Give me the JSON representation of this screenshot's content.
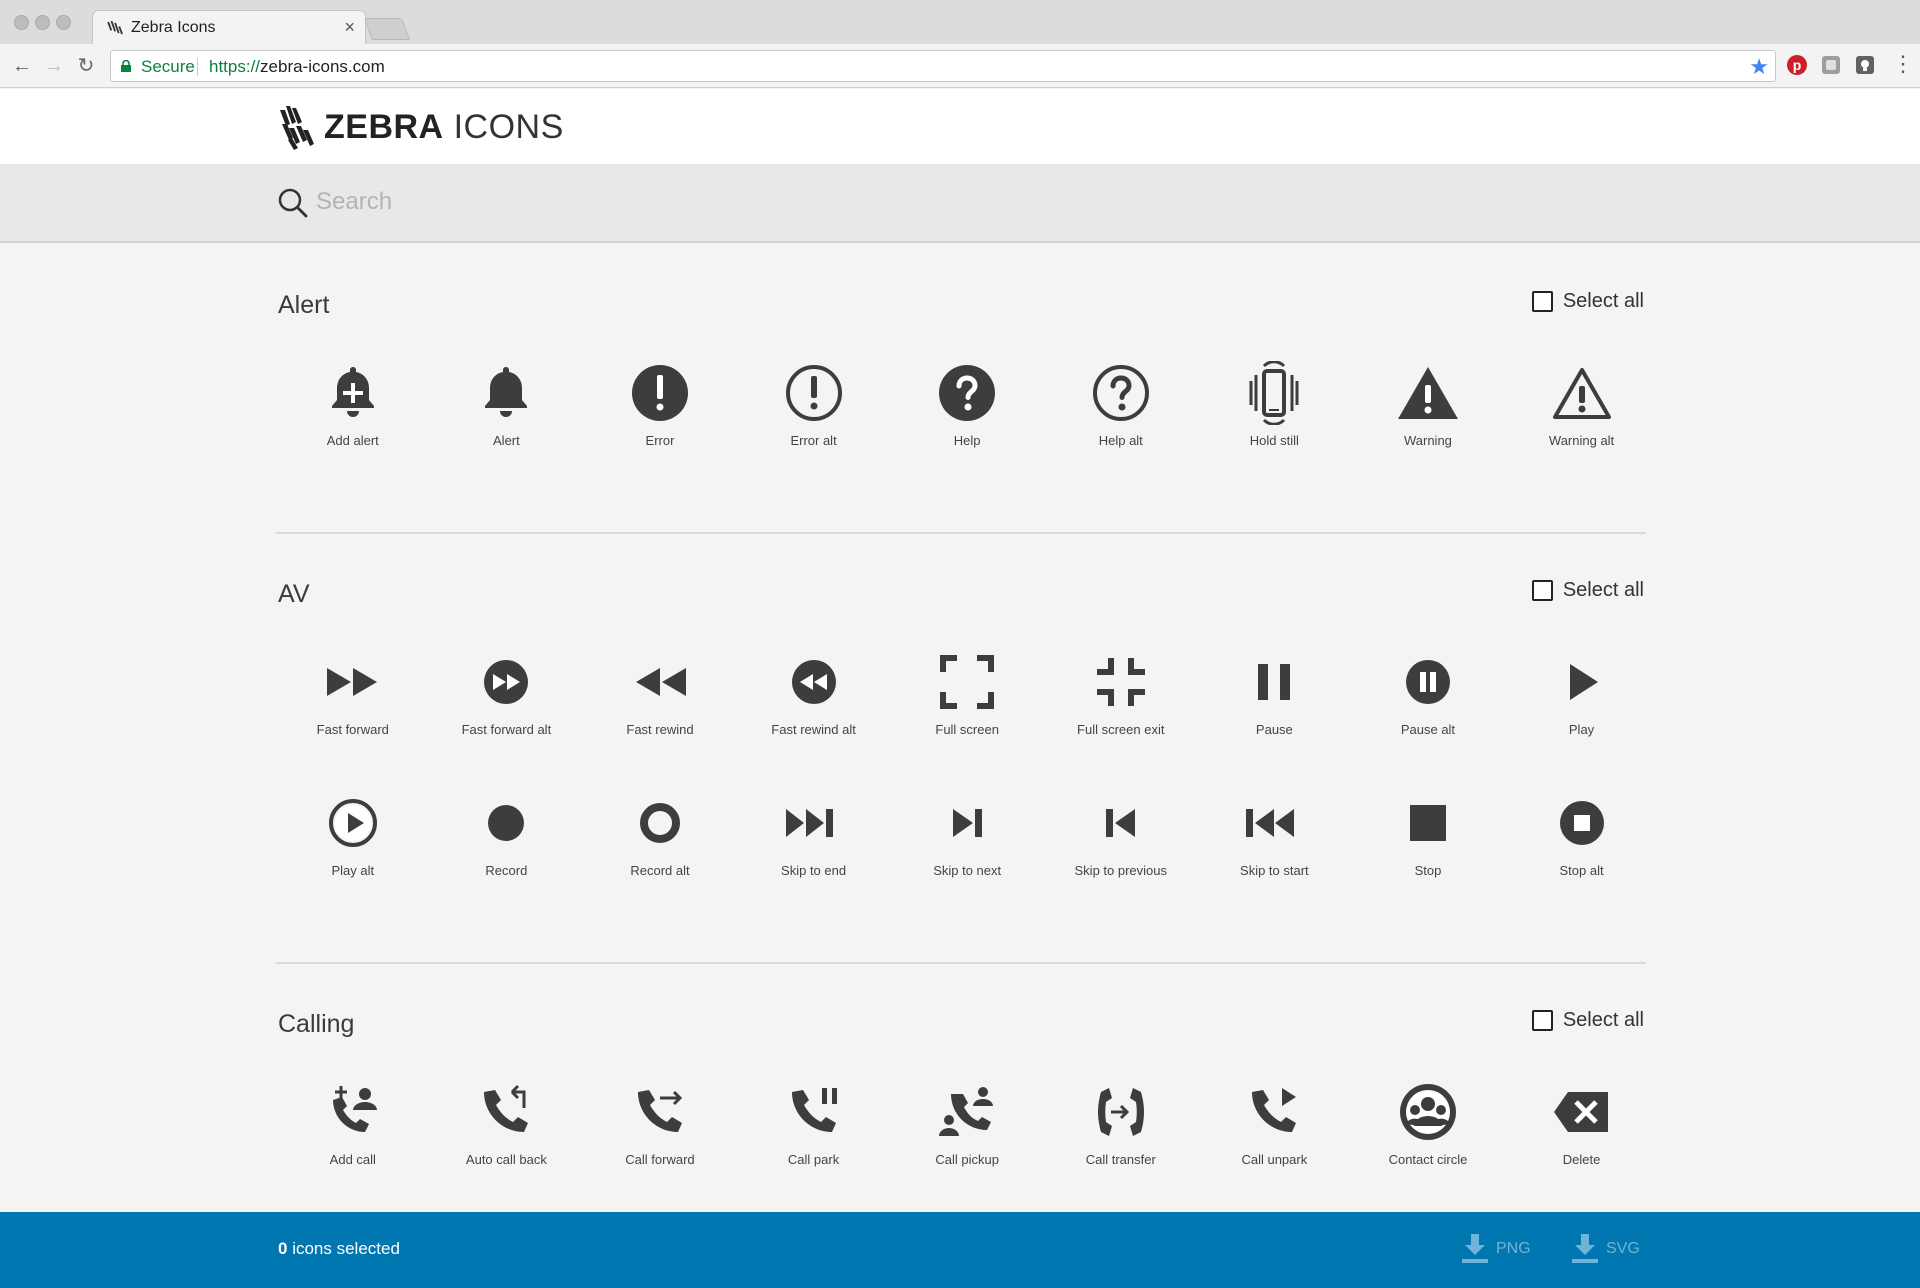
{
  "browser": {
    "tab_title": "Zebra Icons",
    "tab_close": "×",
    "secure_label": "Secure",
    "url_scheme": "https://",
    "url_host": "zebra-icons.com"
  },
  "header": {
    "logo_bold": "ZEBRA",
    "logo_light": "ICONS"
  },
  "search": {
    "placeholder": "Search"
  },
  "sections": [
    {
      "title": "Alert",
      "select_all": "Select all",
      "icons": [
        {
          "label": "Add alert",
          "icon": "add-alert-icon"
        },
        {
          "label": "Alert",
          "icon": "alert-icon"
        },
        {
          "label": "Error",
          "icon": "error-icon"
        },
        {
          "label": "Error alt",
          "icon": "error-alt-icon"
        },
        {
          "label": "Help",
          "icon": "help-icon"
        },
        {
          "label": "Help alt",
          "icon": "help-alt-icon"
        },
        {
          "label": "Hold still",
          "icon": "hold-still-icon"
        },
        {
          "label": "Warning",
          "icon": "warning-icon"
        },
        {
          "label": "Warning alt",
          "icon": "warning-alt-icon"
        }
      ]
    },
    {
      "title": "AV",
      "select_all": "Select all",
      "icons": [
        {
          "label": "Fast forward",
          "icon": "fast-forward-icon"
        },
        {
          "label": "Fast forward alt",
          "icon": "fast-forward-alt-icon"
        },
        {
          "label": "Fast rewind",
          "icon": "fast-rewind-icon"
        },
        {
          "label": "Fast rewind alt",
          "icon": "fast-rewind-alt-icon"
        },
        {
          "label": "Full screen",
          "icon": "full-screen-icon"
        },
        {
          "label": "Full screen exit",
          "icon": "full-screen-exit-icon"
        },
        {
          "label": "Pause",
          "icon": "pause-icon"
        },
        {
          "label": "Pause alt",
          "icon": "pause-alt-icon"
        },
        {
          "label": "Play",
          "icon": "play-icon"
        },
        {
          "label": "Play alt",
          "icon": "play-alt-icon"
        },
        {
          "label": "Record",
          "icon": "record-icon"
        },
        {
          "label": "Record alt",
          "icon": "record-alt-icon"
        },
        {
          "label": "Skip to end",
          "icon": "skip-to-end-icon"
        },
        {
          "label": "Skip to next",
          "icon": "skip-to-next-icon"
        },
        {
          "label": "Skip to previous",
          "icon": "skip-to-previous-icon"
        },
        {
          "label": "Skip to start",
          "icon": "skip-to-start-icon"
        },
        {
          "label": "Stop",
          "icon": "stop-icon"
        },
        {
          "label": "Stop alt",
          "icon": "stop-alt-icon"
        }
      ]
    },
    {
      "title": "Calling",
      "select_all": "Select all",
      "icons": [
        {
          "label": "Add call",
          "icon": "add-call-icon"
        },
        {
          "label": "Auto call back",
          "icon": "auto-call-back-icon"
        },
        {
          "label": "Call forward",
          "icon": "call-forward-icon"
        },
        {
          "label": "Call park",
          "icon": "call-park-icon"
        },
        {
          "label": "Call pickup",
          "icon": "call-pickup-icon"
        },
        {
          "label": "Call transfer",
          "icon": "call-transfer-icon"
        },
        {
          "label": "Call unpark",
          "icon": "call-unpark-icon"
        },
        {
          "label": "Contact circle",
          "icon": "contact-circle-icon"
        },
        {
          "label": "Delete",
          "icon": "delete-icon"
        }
      ]
    }
  ],
  "footer": {
    "count": "0",
    "count_suffix": " icons selected",
    "png_label": "PNG",
    "svg_label": "SVG"
  },
  "colors": {
    "icon": "#3d3d3d",
    "footer_bg": "#0077b1",
    "secure_green": "#0b8043"
  }
}
